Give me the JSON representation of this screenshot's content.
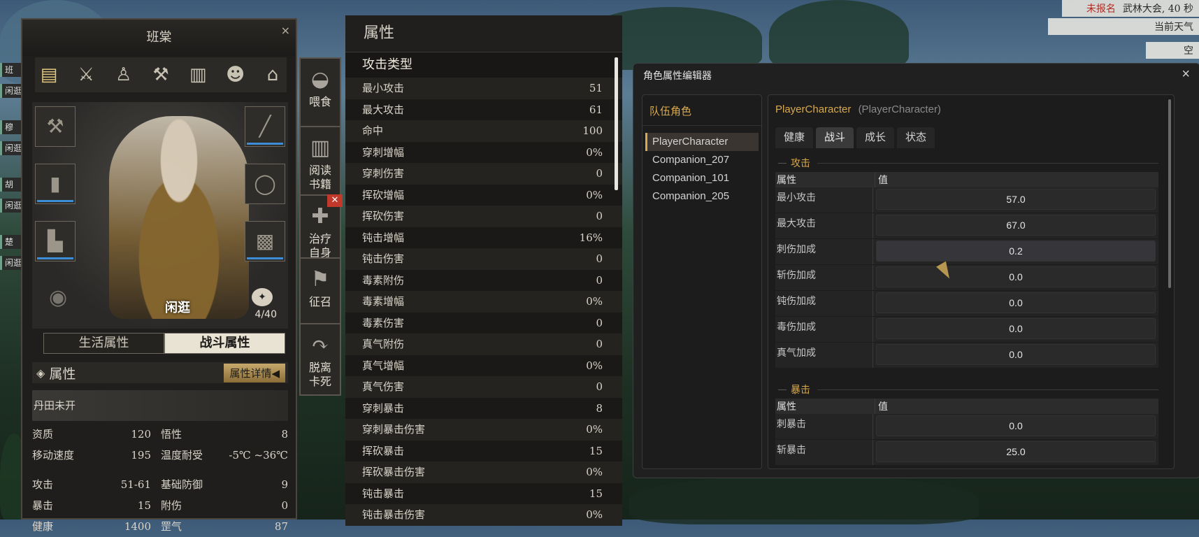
{
  "hud": {
    "line1_red": "未报名",
    "line1": "武林大会, 40 秒",
    "line2": "当前天气",
    "line3": "空"
  },
  "edge_party": [
    "班",
    "闲逛",
    "穆",
    "闲逛",
    "胡",
    "闲逛",
    "楚",
    "闲逛"
  ],
  "character": {
    "title": "班棠",
    "close": "×",
    "tab_icons": [
      "scroll-icon",
      "weapons-icon",
      "figure-icon",
      "pick-icon",
      "book-icon",
      "mask-icon",
      "stand-icon"
    ],
    "slots_left": [
      "axe-icon",
      "pants-icon",
      "boots-icon"
    ],
    "slots_right": [
      "spear-icon",
      "ring-icon",
      "robe-icon"
    ],
    "name_tag": "闲逛",
    "capacity": "4/40",
    "subtabs": [
      "生活属性",
      "战斗属性"
    ],
    "attr_header": "属性",
    "attr_detail": "属性详情◀",
    "dantian": "丹田未开",
    "stats_top": [
      {
        "l": "资质",
        "v": "120",
        "r": "悟性",
        "rv": "8"
      },
      {
        "l": "移动速度",
        "v": "195",
        "r": "温度耐受",
        "rv": "-5℃ ~36℃"
      }
    ],
    "stats_bottom": [
      {
        "l": "攻击",
        "v": "51-61",
        "r": "基础防御",
        "rv": "9"
      },
      {
        "l": "暴击",
        "v": "15",
        "r": "附伤",
        "rv": "0"
      },
      {
        "l": "健康",
        "v": "1400",
        "r": "罡气",
        "rv": "87"
      }
    ]
  },
  "side_buttons": [
    "喂食",
    "阅读书籍",
    "治疗自身",
    "征召",
    "脱离卡死"
  ],
  "attr_panel": {
    "title": "属性",
    "section": "攻击类型",
    "rows": [
      [
        "最小攻击",
        "51"
      ],
      [
        "最大攻击",
        "61"
      ],
      [
        "命中",
        "100"
      ],
      [
        "穿刺增幅",
        "0%"
      ],
      [
        "穿刺伤害",
        "0"
      ],
      [
        "挥砍增幅",
        "0%"
      ],
      [
        "挥砍伤害",
        "0"
      ],
      [
        "钝击增幅",
        "16%"
      ],
      [
        "钝击伤害",
        "0"
      ],
      [
        "毒素附伤",
        "0"
      ],
      [
        "毒素增幅",
        "0%"
      ],
      [
        "毒素伤害",
        "0"
      ],
      [
        "真气附伤",
        "0"
      ],
      [
        "真气增幅",
        "0%"
      ],
      [
        "真气伤害",
        "0"
      ],
      [
        "穿刺暴击",
        "8"
      ],
      [
        "穿刺暴击伤害",
        "0%"
      ],
      [
        "挥砍暴击",
        "15"
      ],
      [
        "挥砍暴击伤害",
        "0%"
      ],
      [
        "钝击暴击",
        "15"
      ],
      [
        "钝击暴击伤害",
        "0%"
      ]
    ]
  },
  "editor": {
    "title": "角色属性编辑器",
    "close": "×",
    "party_title": "队伍角色",
    "party": [
      "PlayerCharacter",
      "Companion_207",
      "Companion_101",
      "Companion_205"
    ],
    "selected_name": "PlayerCharacter",
    "selected_sub": "(PlayerCharacter)",
    "tabs": [
      "健康",
      "战斗",
      "成长",
      "状态"
    ],
    "col_attr": "属性",
    "col_val": "值",
    "sec_attack": "攻击",
    "attack_rows": [
      [
        "最小攻击",
        "57.0"
      ],
      [
        "最大攻击",
        "67.0"
      ],
      [
        "刺伤加成",
        "0.2"
      ],
      [
        "斩伤加成",
        "0.0"
      ],
      [
        "钝伤加成",
        "0.0"
      ],
      [
        "毒伤加成",
        "0.0"
      ],
      [
        "真气加成",
        "0.0"
      ]
    ],
    "sec_crit": "暴击",
    "crit_rows": [
      [
        "刺暴击",
        "0.0"
      ],
      [
        "斩暴击",
        "25.0"
      ]
    ]
  }
}
